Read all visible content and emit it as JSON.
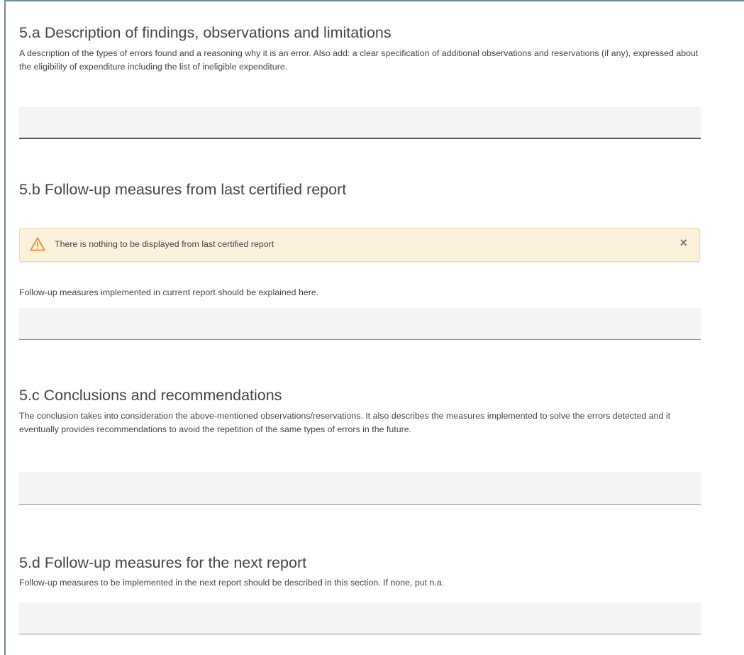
{
  "section_a": {
    "title": "5.a Description of findings, observations and limitations",
    "description": "A description of the types of errors found and a reasoning why it is an error. Also add: a clear specification of additional observations and reservations (if any), expressed about the eligibility of expenditure including the list of ineligible expenditure."
  },
  "section_b": {
    "title": "5.b Follow-up measures from last certified report",
    "alert": {
      "message": "There is nothing to be displayed from last certified report",
      "icon": "warning-triangle-icon",
      "close_label": "×"
    },
    "description": "Follow-up measures implemented in current report should be explained here."
  },
  "section_c": {
    "title": "5.c Conclusions and recommendations",
    "description": "The conclusion takes into consideration the above-mentioned observations/reservations. It also describes the measures implemented to solve the errors detected and it eventually provides recommendations to avoid the repetition of the same types of errors in the future."
  },
  "section_d": {
    "title": "5.d Follow-up measures for the next report",
    "description": "Follow-up measures to be implemented in the next report should be described in this section. If none, put n.a."
  },
  "colors": {
    "alert_background": "#fcf2dc",
    "alert_border": "#f3d9a4",
    "warning_icon": "#e8912c",
    "field_background": "#f4f4f4",
    "frame_border": "#6f8a9c"
  }
}
